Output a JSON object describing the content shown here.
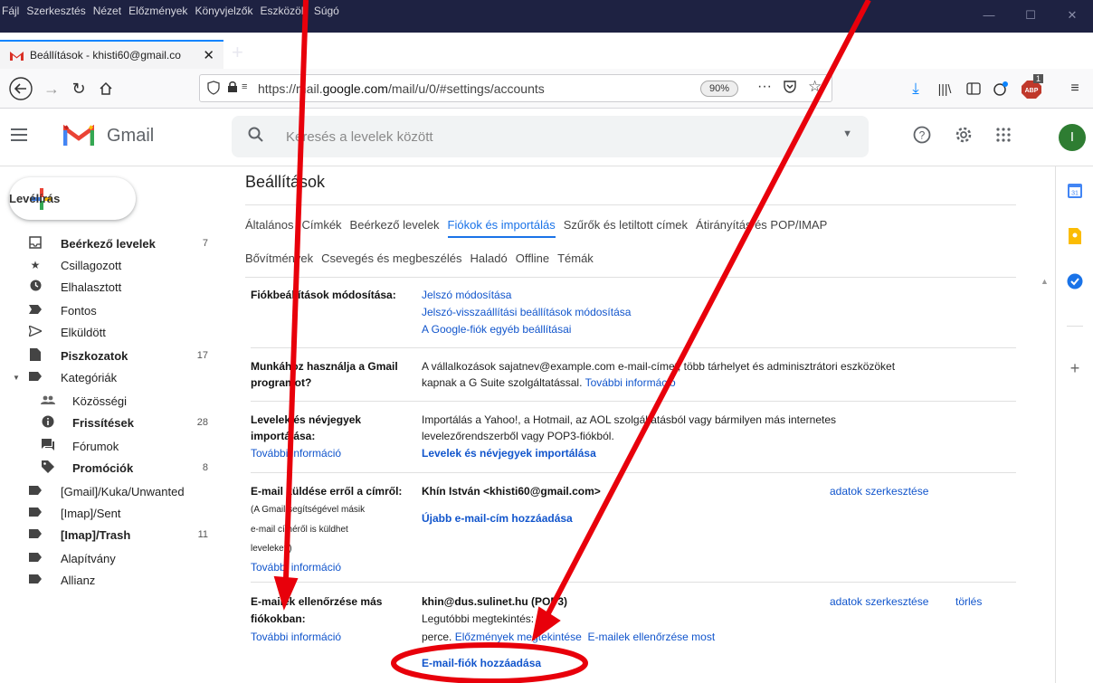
{
  "browser": {
    "menu": [
      "Fájl",
      "Szerkesztés",
      "Nézet",
      "Előzmények",
      "Könyvjelzők",
      "Eszközök",
      "Súgó"
    ],
    "tab_title": "Beállítások - khisti60@gmail.co",
    "url_prefix": "https://mail.",
    "url_domain": "google.com",
    "url_path": "/mail/u/0/#settings/accounts",
    "zoom": "90%",
    "abp_badge": "1"
  },
  "gmail": {
    "logo_text": "Gmail",
    "search_placeholder": "Keresés a levelek között",
    "avatar_letter": "I",
    "compose_label": "Levélírás"
  },
  "sidebar": {
    "items": [
      {
        "label": "Beérkező levelek",
        "count": "7",
        "icon": "inbox-icon",
        "bold": true
      },
      {
        "label": "Csillagozott",
        "count": "",
        "icon": "star-icon",
        "bold": false
      },
      {
        "label": "Elhalasztott",
        "count": "",
        "icon": "clock-icon",
        "bold": false
      },
      {
        "label": "Fontos",
        "count": "",
        "icon": "important-icon",
        "bold": false
      },
      {
        "label": "Elküldött",
        "count": "",
        "icon": "send-icon",
        "bold": false
      },
      {
        "label": "Piszkozatok",
        "count": "17",
        "icon": "draft-icon",
        "bold": true
      },
      {
        "label": "Kategóriák",
        "count": "",
        "icon": "label-icon",
        "bold": false
      },
      {
        "label": "Közösségi",
        "count": "",
        "icon": "people-icon",
        "bold": false
      },
      {
        "label": "Frissítések",
        "count": "28",
        "icon": "info-icon",
        "bold": true
      },
      {
        "label": "Fórumok",
        "count": "",
        "icon": "forum-icon",
        "bold": false
      },
      {
        "label": "Promóciók",
        "count": "8",
        "icon": "tag-icon",
        "bold": true
      },
      {
        "label": "[Gmail]/Kuka/Unwanted",
        "count": "",
        "icon": "label-icon",
        "bold": false
      },
      {
        "label": "[Imap]/Sent",
        "count": "",
        "icon": "label-icon",
        "bold": false
      },
      {
        "label": "[Imap]/Trash",
        "count": "11",
        "icon": "label-icon",
        "bold": true
      },
      {
        "label": "Alapítvány",
        "count": "",
        "icon": "label-icon",
        "bold": false
      },
      {
        "label": "Allianz",
        "count": "",
        "icon": "label-icon",
        "bold": false
      }
    ]
  },
  "settings": {
    "title": "Beállítások",
    "tabs_row1": [
      "Általános",
      "Címkék",
      "Beérkező levelek",
      "Fiókok és importálás",
      "Szűrők és letiltott címek",
      "Átirányítás és POP/IMAP"
    ],
    "tabs_row2": [
      "Bővítmények",
      "Csevegés és megbeszélés",
      "Haladó",
      "Offline",
      "Témák"
    ],
    "active_tab": "Fiókok és importálás",
    "sec1": {
      "label": "Fiókbeállítások módosítása:",
      "links": [
        "Jelszó módosítása",
        "Jelszó-visszaállítási beállítások módosítása",
        "A Google-fiók egyéb beállításai"
      ]
    },
    "sec2": {
      "label_line1": "Munkához használja a Gmail",
      "label_line2": "programot?",
      "text_line1": "A vállalkozások sajatnev@example.com e-mail-címet, több tárhelyet és adminisztrátori eszközöket",
      "text_line2": "kapnak a G Suite szolgáltatással.",
      "link": "További információ"
    },
    "sec3": {
      "label_line1": "Levelek és névjegyek",
      "label_line2": "importálása:",
      "more": "További információ",
      "text_line1": "Importálás a Yahoo!, a Hotmail, az AOL szolgáltatásból vagy bármilyen más internetes",
      "text_line2": "levelezőrendszerből vagy POP3-fiókból.",
      "action": "Levelek és névjegyek importálása"
    },
    "sec4": {
      "label": "E-mail küldése erről a címről:",
      "note1": "(A Gmail segítségével másik",
      "note2": "e-mail címéről is küldhet",
      "note3": "leveleket.)",
      "more": "További információ",
      "address": "Khín István <khisti60@gmail.com>",
      "edit": "adatok szerkesztése",
      "add": "Újabb e-mail-cím hozzáadása"
    },
    "sec5": {
      "label_line1": "E-mailek ellenőrzése más",
      "label_line2": "fiókokban:",
      "more": "További információ",
      "account": "khin@dus.sulinet.hu (POP3)",
      "last_line1": "Legutóbbi megtekintés: 54",
      "last_line2": "perce.",
      "history": "Előzmények megtekintése",
      "check_now": "E-mailek ellenőrzése most",
      "edit": "adatok szerkesztése",
      "delete": "törlés",
      "add": "E-mail-fiók hozzáadása"
    }
  },
  "annotation": {
    "color": "#e8000b"
  }
}
